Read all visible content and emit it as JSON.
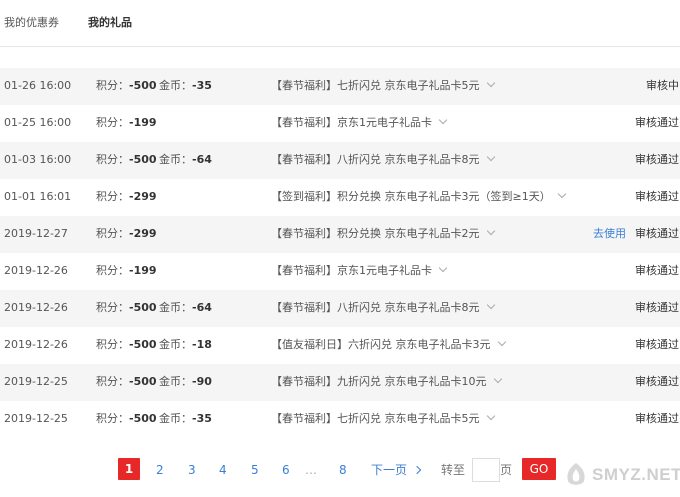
{
  "tabs": [
    "我的优惠券",
    "我的礼品"
  ],
  "records": [
    {
      "date": "01-26 16:00",
      "points_label": "积分：",
      "points": "-500",
      "coins_label": "金币：",
      "coins": "-35",
      "item": "【春节福利】七折闪兑 京东电子礼品卡5元",
      "action": "",
      "status": "审核中"
    },
    {
      "date": "01-25 16:00",
      "points_label": "积分：",
      "points": "-199",
      "coins_label": "",
      "coins": "",
      "item": "【春节福利】京东1元电子礼品卡",
      "action": "",
      "status": "审核通过"
    },
    {
      "date": "01-03 16:00",
      "points_label": "积分：",
      "points": "-500",
      "coins_label": "金币：",
      "coins": "-64",
      "item": "【春节福利】八折闪兑 京东电子礼品卡8元",
      "action": "",
      "status": "审核通过"
    },
    {
      "date": "01-01 16:01",
      "points_label": "积分：",
      "points": "-299",
      "coins_label": "",
      "coins": "",
      "item": "【签到福利】积分兑换 京东电子礼品卡3元（签到≥1天）",
      "action": "",
      "status": "审核通过"
    },
    {
      "date": "2019-12-27",
      "points_label": "积分：",
      "points": "-299",
      "coins_label": "",
      "coins": "",
      "item": "【春节福利】积分兑换 京东电子礼品卡2元",
      "action": "去使用",
      "status": "审核通过"
    },
    {
      "date": "2019-12-26",
      "points_label": "积分：",
      "points": "-199",
      "coins_label": "",
      "coins": "",
      "item": "【春节福利】京东1元电子礼品卡",
      "action": "",
      "status": "审核通过"
    },
    {
      "date": "2019-12-26",
      "points_label": "积分：",
      "points": "-500",
      "coins_label": "金币：",
      "coins": "-64",
      "item": "【春节福利】八折闪兑 京东电子礼品卡8元",
      "action": "",
      "status": "审核通过"
    },
    {
      "date": "2019-12-26",
      "points_label": "积分：",
      "points": "-500",
      "coins_label": "金币：",
      "coins": "-18",
      "item": "【值友福利日】六折闪兑 京东电子礼品卡3元",
      "action": "",
      "status": "审核通过"
    },
    {
      "date": "2019-12-25",
      "points_label": "积分：",
      "points": "-500",
      "coins_label": "金币：",
      "coins": "-90",
      "item": "【春节福利】九折闪兑 京东电子礼品卡10元",
      "action": "",
      "status": "审核通过"
    },
    {
      "date": "2019-12-25",
      "points_label": "积分：",
      "points": "-500",
      "coins_label": "金币：",
      "coins": "-35",
      "item": "【春节福利】七折闪兑 京东电子礼品卡5元",
      "action": "",
      "status": "审核通过"
    }
  ],
  "pagination": {
    "pages": [
      "1",
      "2",
      "3",
      "4",
      "5",
      "6"
    ],
    "current": "1",
    "ellipsis": "…",
    "last": "8",
    "next": "下一页",
    "goto_prefix": "转至",
    "goto_value": "",
    "goto_suffix": "页",
    "go": "GO"
  },
  "watermark": {
    "text": "SMYZ.NET"
  },
  "colors": {
    "accent": "#e62828",
    "link": "#3b7fd4",
    "row_alt": "#f5f5f5"
  },
  "icons": {
    "dropdown": "chevron-down-icon",
    "next": "chevron-right-icon"
  }
}
